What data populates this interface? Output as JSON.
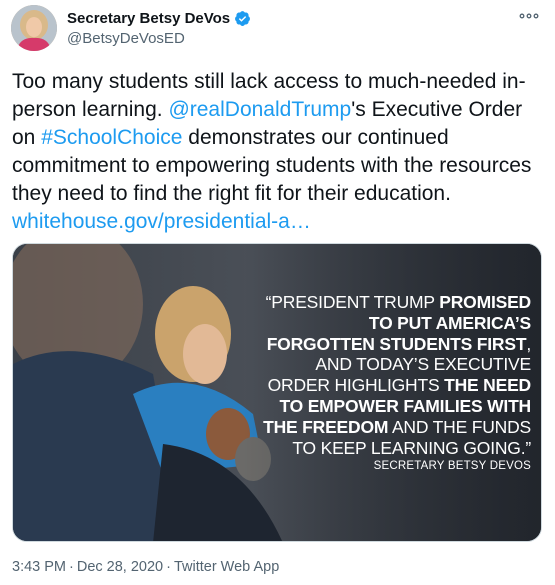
{
  "author": {
    "name": "Secretary Betsy DeVos",
    "handle": "@BetsyDeVosED",
    "verified": true,
    "avatar_icon": "profile-photo"
  },
  "menu_icon": "more-options-icon",
  "tweet": {
    "text_1": "Too many students still lack access to much-needed in-person learning. ",
    "mention": "@realDonaldTrump",
    "text_2": "'s Executive Order on ",
    "hashtag": "#SchoolChoice",
    "text_3": " demonstrates our continued commitment to empowering students with the resources they need to find the right fit for their education. ",
    "link": "whitehouse.gov/presidential-a…",
    "link_color": "#1d9bf0"
  },
  "media": {
    "quote_1": "“PRESIDENT TRUMP ",
    "quote_2": "PROMISED TO PUT AMERICA’S FORGOTTEN STUDENTS FIRST",
    "quote_3": ", AND TODAY’S EXECUTIVE ORDER HIGHLIGHTS ",
    "quote_4": "THE NEED TO EMPOWER FAMILIES WITH THE FREEDOM",
    "quote_5": " AND THE FUNDS TO KEEP LEARNING GOING.”",
    "attribution": "SECRETARY BETSY DEVOS"
  },
  "meta": {
    "time": "3:43 PM",
    "separator": "·",
    "date": "Dec 28, 2020",
    "app": "Twitter Web App"
  }
}
